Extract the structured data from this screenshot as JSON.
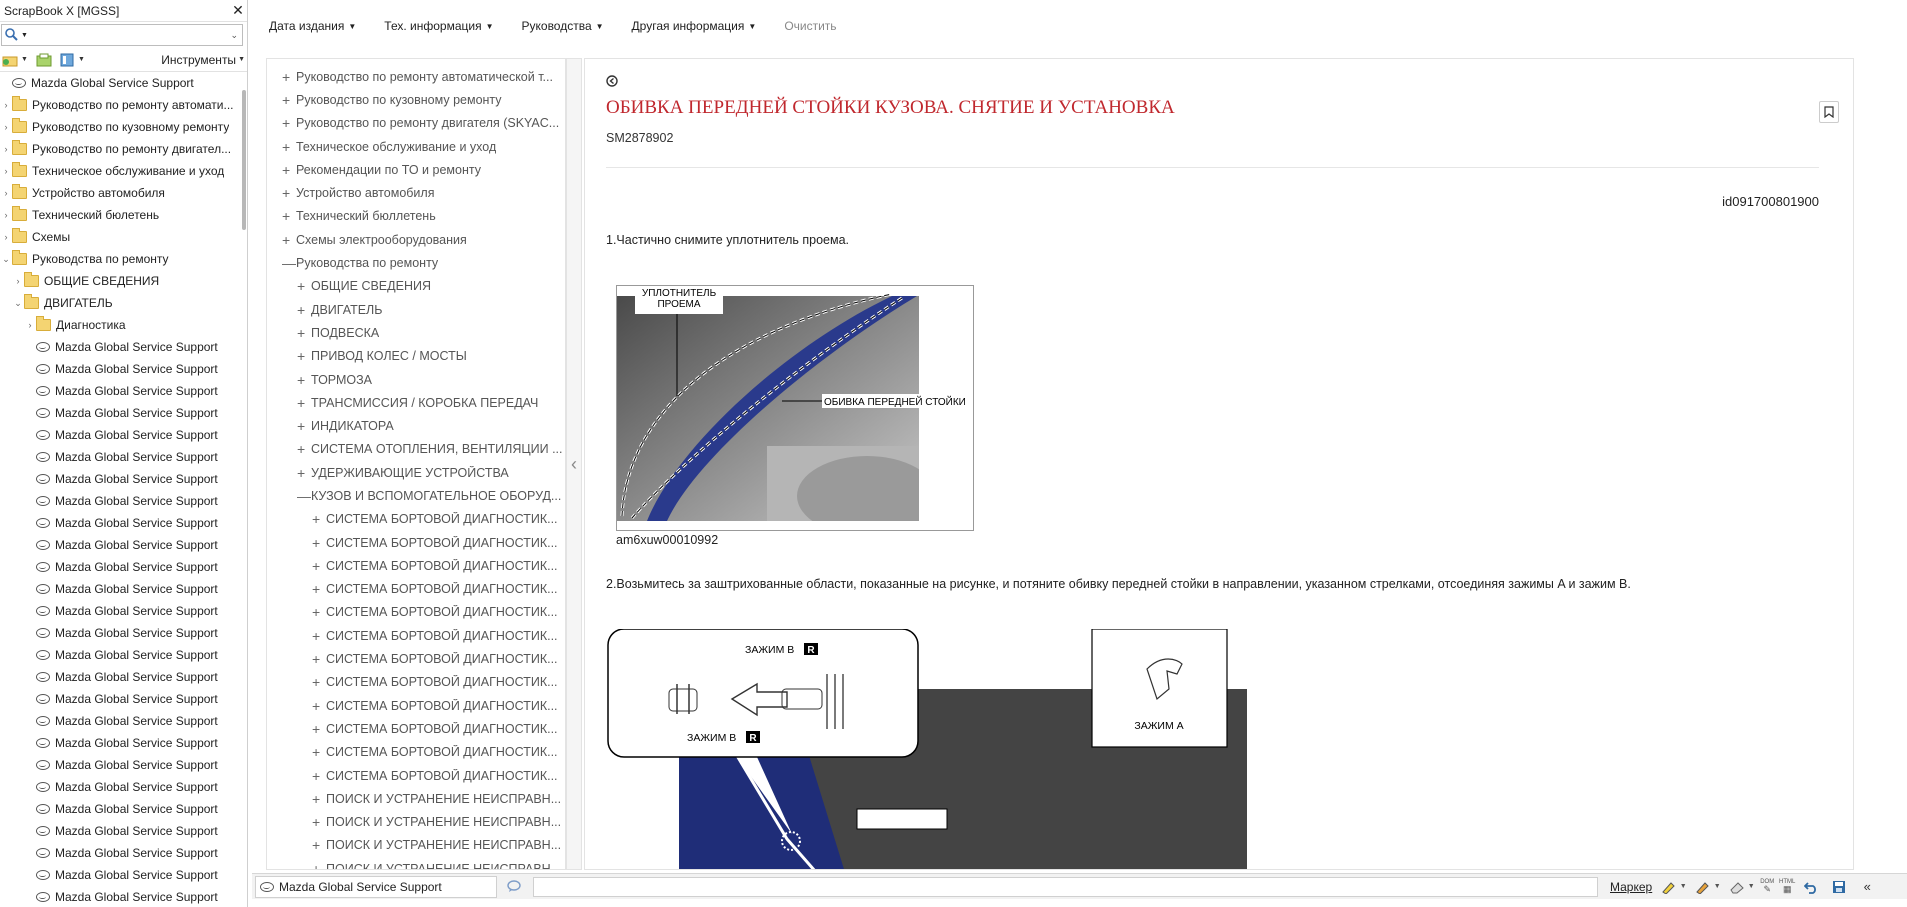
{
  "window": {
    "title": "ScrapBook X [MGSS]",
    "close_glyph": "✕"
  },
  "toolbar": {
    "tools_label": "Инструменты"
  },
  "tree": [
    {
      "type": "mazda",
      "label": "Mazda Global Service Support",
      "indent": 0,
      "exp": ""
    },
    {
      "type": "folder",
      "label": "Руководство по ремонту автомати...",
      "indent": 0,
      "exp": "›"
    },
    {
      "type": "folder",
      "label": "Руководство по кузовному ремонту",
      "indent": 0,
      "exp": "›"
    },
    {
      "type": "folder",
      "label": "Руководство по ремонту двигател...",
      "indent": 0,
      "exp": "›"
    },
    {
      "type": "folder",
      "label": "Техническое обслуживание и уход",
      "indent": 0,
      "exp": "›"
    },
    {
      "type": "folder",
      "label": "Устройство автомобиля",
      "indent": 0,
      "exp": "›"
    },
    {
      "type": "folder",
      "label": "Технический бюлетень",
      "indent": 0,
      "exp": "›"
    },
    {
      "type": "folder",
      "label": "Схемы",
      "indent": 0,
      "exp": "›"
    },
    {
      "type": "folder",
      "label": "Руководства по ремонту",
      "indent": 0,
      "exp": "⌄"
    },
    {
      "type": "folder",
      "label": "ОБЩИЕ СВЕДЕНИЯ",
      "indent": 1,
      "exp": "›"
    },
    {
      "type": "folder",
      "label": "ДВИГАТЕЛЬ",
      "indent": 1,
      "exp": "⌄"
    },
    {
      "type": "folder",
      "label": "Диагностика",
      "indent": 2,
      "exp": "›"
    },
    {
      "type": "mazda",
      "label": "Mazda Global Service Support",
      "indent": 2,
      "exp": ""
    },
    {
      "type": "mazda",
      "label": "Mazda Global Service Support",
      "indent": 2,
      "exp": ""
    },
    {
      "type": "mazda",
      "label": "Mazda Global Service Support",
      "indent": 2,
      "exp": ""
    },
    {
      "type": "mazda",
      "label": "Mazda Global Service Support",
      "indent": 2,
      "exp": ""
    },
    {
      "type": "mazda",
      "label": "Mazda Global Service Support",
      "indent": 2,
      "exp": ""
    },
    {
      "type": "mazda",
      "label": "Mazda Global Service Support",
      "indent": 2,
      "exp": ""
    },
    {
      "type": "mazda",
      "label": "Mazda Global Service Support",
      "indent": 2,
      "exp": ""
    },
    {
      "type": "mazda",
      "label": "Mazda Global Service Support",
      "indent": 2,
      "exp": ""
    },
    {
      "type": "mazda",
      "label": "Mazda Global Service Support",
      "indent": 2,
      "exp": ""
    },
    {
      "type": "mazda",
      "label": "Mazda Global Service Support",
      "indent": 2,
      "exp": ""
    },
    {
      "type": "mazda",
      "label": "Mazda Global Service Support",
      "indent": 2,
      "exp": ""
    },
    {
      "type": "mazda",
      "label": "Mazda Global Service Support",
      "indent": 2,
      "exp": ""
    },
    {
      "type": "mazda",
      "label": "Mazda Global Service Support",
      "indent": 2,
      "exp": ""
    },
    {
      "type": "mazda",
      "label": "Mazda Global Service Support",
      "indent": 2,
      "exp": ""
    },
    {
      "type": "mazda",
      "label": "Mazda Global Service Support",
      "indent": 2,
      "exp": ""
    },
    {
      "type": "mazda",
      "label": "Mazda Global Service Support",
      "indent": 2,
      "exp": ""
    },
    {
      "type": "mazda",
      "label": "Mazda Global Service Support",
      "indent": 2,
      "exp": ""
    },
    {
      "type": "mazda",
      "label": "Mazda Global Service Support",
      "indent": 2,
      "exp": ""
    },
    {
      "type": "mazda",
      "label": "Mazda Global Service Support",
      "indent": 2,
      "exp": ""
    },
    {
      "type": "mazda",
      "label": "Mazda Global Service Support",
      "indent": 2,
      "exp": ""
    },
    {
      "type": "mazda",
      "label": "Mazda Global Service Support",
      "indent": 2,
      "exp": ""
    },
    {
      "type": "mazda",
      "label": "Mazda Global Service Support",
      "indent": 2,
      "exp": ""
    },
    {
      "type": "mazda",
      "label": "Mazda Global Service Support",
      "indent": 2,
      "exp": ""
    },
    {
      "type": "mazda",
      "label": "Mazda Global Service Support",
      "indent": 2,
      "exp": ""
    },
    {
      "type": "mazda",
      "label": "Mazda Global Service Support",
      "indent": 2,
      "exp": ""
    },
    {
      "type": "mazda",
      "label": "Mazda Global Service Support",
      "indent": 2,
      "exp": ""
    },
    {
      "type": "mazda",
      "label": "Mazda Global Service Support",
      "indent": 2,
      "exp": ""
    }
  ],
  "nav": [
    {
      "label": "Дата издания",
      "caret": "▼"
    },
    {
      "label": "Тех. информация",
      "caret": "▼"
    },
    {
      "label": "Руководства",
      "caret": "▼"
    },
    {
      "label": "Другая информация",
      "caret": "▼"
    }
  ],
  "nav_clear": "Очистить",
  "index": [
    {
      "pm": "+",
      "indent": 0,
      "label": "Руководство по ремонту автоматической т..."
    },
    {
      "pm": "+",
      "indent": 0,
      "label": "Руководство по кузовному ремонту"
    },
    {
      "pm": "+",
      "indent": 0,
      "label": "Руководство по ремонту двигателя (SKYAC..."
    },
    {
      "pm": "+",
      "indent": 0,
      "label": "Техническое обслуживание и уход"
    },
    {
      "pm": "+",
      "indent": 0,
      "label": "Рекомендации по ТО и ремонту"
    },
    {
      "pm": "+",
      "indent": 0,
      "label": "Устройство автомобиля"
    },
    {
      "pm": "+",
      "indent": 0,
      "label": "Технический бюллетень"
    },
    {
      "pm": "+",
      "indent": 0,
      "label": "Схемы электрооборудования"
    },
    {
      "pm": "—",
      "indent": 0,
      "label": "Руководства по ремонту"
    },
    {
      "pm": "+",
      "indent": 1,
      "label": "ОБЩИЕ СВЕДЕНИЯ"
    },
    {
      "pm": "+",
      "indent": 1,
      "label": "ДВИГАТЕЛЬ"
    },
    {
      "pm": "+",
      "indent": 1,
      "label": "ПОДВЕСКА"
    },
    {
      "pm": "+",
      "indent": 1,
      "label": "ПРИВОД КОЛЕС / МОСТЫ"
    },
    {
      "pm": "+",
      "indent": 1,
      "label": "ТОРМОЗА"
    },
    {
      "pm": "+",
      "indent": 1,
      "label": "ТРАНСМИССИЯ / КОРОБКА ПЕРЕДАЧ"
    },
    {
      "pm": "+",
      "indent": 1,
      "label": "ИНДИКАТОРА"
    },
    {
      "pm": "+",
      "indent": 1,
      "label": "СИСТЕМА ОТОПЛЕНИЯ, ВЕНТИЛЯЦИИ ..."
    },
    {
      "pm": "+",
      "indent": 1,
      "label": "УДЕРЖИВАЮЩИЕ УСТРОЙСТВА"
    },
    {
      "pm": "—",
      "indent": 1,
      "label": "КУЗОВ И ВСПОМОГАТЕЛЬНОЕ ОБОРУД..."
    },
    {
      "pm": "+",
      "indent": 2,
      "label": "СИСТЕМА БОРТОВОЙ ДИАГНОСТИК..."
    },
    {
      "pm": "+",
      "indent": 2,
      "label": "СИСТЕМА БОРТОВОЙ ДИАГНОСТИК..."
    },
    {
      "pm": "+",
      "indent": 2,
      "label": "СИСТЕМА БОРТОВОЙ ДИАГНОСТИК..."
    },
    {
      "pm": "+",
      "indent": 2,
      "label": "СИСТЕМА БОРТОВОЙ ДИАГНОСТИК..."
    },
    {
      "pm": "+",
      "indent": 2,
      "label": "СИСТЕМА БОРТОВОЙ ДИАГНОСТИК..."
    },
    {
      "pm": "+",
      "indent": 2,
      "label": "СИСТЕМА БОРТОВОЙ ДИАГНОСТИК..."
    },
    {
      "pm": "+",
      "indent": 2,
      "label": "СИСТЕМА БОРТОВОЙ ДИАГНОСТИК..."
    },
    {
      "pm": "+",
      "indent": 2,
      "label": "СИСТЕМА БОРТОВОЙ ДИАГНОСТИК..."
    },
    {
      "pm": "+",
      "indent": 2,
      "label": "СИСТЕМА БОРТОВОЙ ДИАГНОСТИК..."
    },
    {
      "pm": "+",
      "indent": 2,
      "label": "СИСТЕМА БОРТОВОЙ ДИАГНОСТИК..."
    },
    {
      "pm": "+",
      "indent": 2,
      "label": "СИСТЕМА БОРТОВОЙ ДИАГНОСТИК..."
    },
    {
      "pm": "+",
      "indent": 2,
      "label": "СИСТЕМА БОРТОВОЙ ДИАГНОСТИК..."
    },
    {
      "pm": "+",
      "indent": 2,
      "label": "ПОИСК И УСТРАНЕНИЕ НЕИСПРАВН..."
    },
    {
      "pm": "+",
      "indent": 2,
      "label": "ПОИСК И УСТРАНЕНИЕ НЕИСПРАВН..."
    },
    {
      "pm": "+",
      "indent": 2,
      "label": "ПОИСК И УСТРАНЕНИЕ НЕИСПРАВН..."
    },
    {
      "pm": "+",
      "indent": 2,
      "label": "ПОИСК И УСТРАНЕНИЕ НЕИСПРАВН..."
    }
  ],
  "doc": {
    "title": "ОБИВКА ПЕРЕДНЕЙ СТОЙКИ КУЗОВА. СНЯТИЕ И УСТАНОВКА",
    "code": "SM2878902",
    "id": "id091700801900",
    "step1": "1.Частично снимите уплотнитель проема.",
    "fig1": {
      "label_seal_line1": "УПЛОТНИТЕЛЬ",
      "label_seal_line2": "ПРОЕМА",
      "label_trim": "ОБИВКА ПЕРЕДНЕЙ СТОЙКИ",
      "caption": "am6xuw00010992"
    },
    "step2": "2.Возьмитесь за заштрихованные области, показанные на рисунке, и потяните обивку передней стойки в направлении, указанном стрелками, отсоединяя зажимы A и зажим B.",
    "fig2": {
      "clip_b_top": "ЗАЖИМ B",
      "clip_b_bottom": "ЗАЖИМ B",
      "r_badge": "R",
      "clip_a": "ЗАЖИМ A"
    }
  },
  "status": {
    "title": "Mazda Global Service Support",
    "marker": "Маркер",
    "dom_label": "DOM",
    "html_label": "HTML"
  },
  "colors": {
    "title_red": "#c0282e",
    "trim_blue": "#2a3a8c"
  }
}
